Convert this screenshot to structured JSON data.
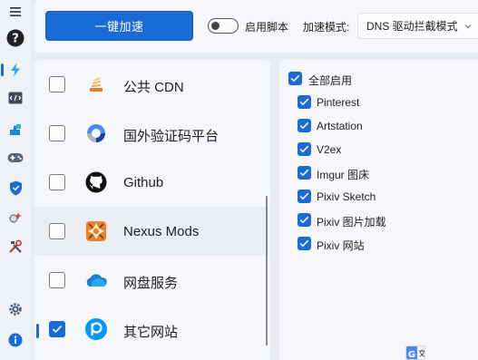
{
  "rail": {
    "items": [
      {
        "icon": "menu-icon"
      },
      {
        "icon": "help-icon"
      },
      {
        "icon": "lightning-icon",
        "active": true
      },
      {
        "icon": "code-icon"
      },
      {
        "icon": "puzzle-icon"
      },
      {
        "icon": "gamepad-icon"
      },
      {
        "icon": "shield-icon"
      },
      {
        "icon": "spark-icon"
      },
      {
        "icon": "tools-icon"
      },
      {
        "icon": "settings-icon"
      },
      {
        "icon": "info-icon"
      }
    ],
    "accent": "#1a6bd6"
  },
  "toolbar": {
    "accelerate_label": "一键加速",
    "script_toggle_label": "启用脚本",
    "script_toggle_on": false,
    "mode_label": "加速模式:",
    "mode_value": "DNS 驱动拦截模式"
  },
  "services": [
    {
      "label": "公共 CDN",
      "checked": false,
      "icon": "stack-icon"
    },
    {
      "label": "国外验证码平台",
      "checked": false,
      "icon": "recaptcha-icon"
    },
    {
      "label": "Github",
      "checked": false,
      "icon": "github-icon"
    },
    {
      "label": "Nexus Mods",
      "checked": false,
      "icon": "nexus-mods-icon"
    },
    {
      "label": "网盘服务",
      "checked": false,
      "icon": "onedrive-cloud-icon"
    },
    {
      "label": "其它网站",
      "checked": true,
      "icon": "pixiv-icon",
      "selected": true
    }
  ],
  "sub_services": {
    "select_all_label": "全部启用",
    "select_all_checked": true,
    "items": [
      {
        "label": "Pinterest",
        "checked": true
      },
      {
        "label": "Artstation",
        "checked": true
      },
      {
        "label": "V2ex",
        "checked": true
      },
      {
        "label": "Imgur 图床",
        "checked": true
      },
      {
        "label": "Pixiv Sketch",
        "checked": true
      },
      {
        "label": "Pixiv 图片加载",
        "checked": true
      },
      {
        "label": "Pixiv 网站",
        "checked": true
      }
    ]
  }
}
